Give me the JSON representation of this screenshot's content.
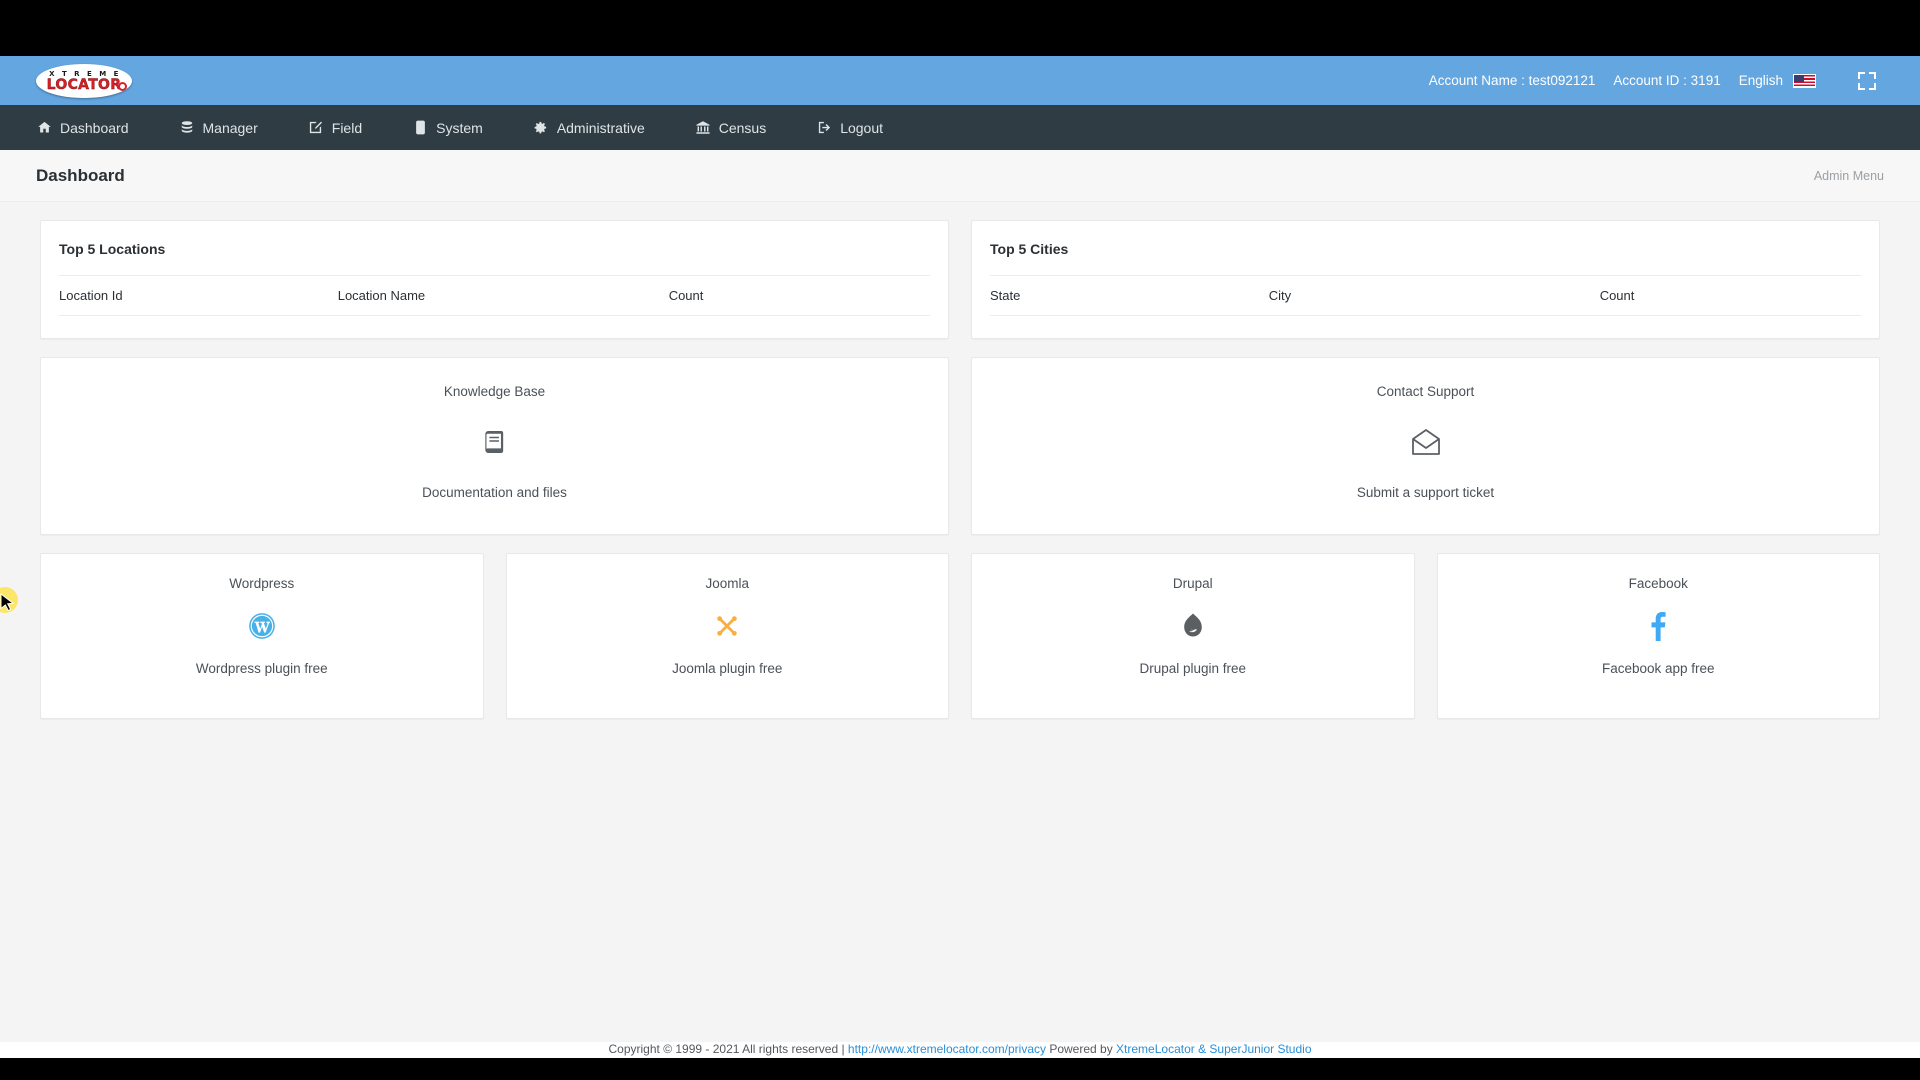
{
  "header": {
    "logo_line1": "X T R E M E",
    "logo_line2": "LOCATOR",
    "account_name": "Account Name : test092121",
    "account_id": "Account ID : 3191",
    "language": "English",
    "flag_icon": "us-flag-icon",
    "fullscreen_icon": "fullscreen-icon"
  },
  "nav": {
    "items": [
      {
        "label": "Dashboard",
        "icon": "home-icon"
      },
      {
        "label": "Manager",
        "icon": "database-icon"
      },
      {
        "label": "Field",
        "icon": "edit-square-icon"
      },
      {
        "label": "System",
        "icon": "server-icon"
      },
      {
        "label": "Administrative",
        "icon": "gear-icon"
      },
      {
        "label": "Census",
        "icon": "bank-icon"
      },
      {
        "label": "Logout",
        "icon": "sign-out-icon"
      }
    ]
  },
  "page": {
    "title": "Dashboard",
    "admin_menu": "Admin Menu"
  },
  "panels": {
    "top_locations": {
      "title": "Top 5 Locations",
      "columns": [
        "Location Id",
        "Location Name",
        "Count"
      ],
      "rows": []
    },
    "top_cities": {
      "title": "Top 5 Cities",
      "columns": [
        "State",
        "City",
        "Count"
      ],
      "rows": []
    }
  },
  "cards": {
    "knowledge_base": {
      "title": "Knowledge Base",
      "icon": "book-icon",
      "subtitle": "Documentation and files"
    },
    "contact_support": {
      "title": "Contact Support",
      "icon": "envelope-open-icon",
      "subtitle": "Submit a support ticket"
    }
  },
  "plugins": [
    {
      "title": "Wordpress",
      "icon": "wordpress-icon",
      "subtitle": "Wordpress plugin free",
      "color": "#44b0e8"
    },
    {
      "title": "Joomla",
      "icon": "joomla-icon",
      "subtitle": "Joomla plugin free",
      "color": "#f9ae41"
    },
    {
      "title": "Drupal",
      "icon": "drupal-icon",
      "subtitle": "Drupal plugin free",
      "color": "#5b5f61"
    },
    {
      "title": "Facebook",
      "icon": "facebook-icon",
      "subtitle": "Facebook app free",
      "color": "#3fa9f5"
    }
  ],
  "footer": {
    "copyright": "Copyright © 1999 - 2021 All rights reserved | ",
    "privacy": "http://www.xtremelocator.com/privacy",
    "powered": "   Powered by ",
    "powered_link": "XtremeLocator & SuperJunior Studio"
  },
  "colors": {
    "header_blue": "#64a6e0",
    "nav_dark": "#2f3c44",
    "page_bg": "#f4f4f4",
    "link_blue": "#2a8fd8"
  }
}
